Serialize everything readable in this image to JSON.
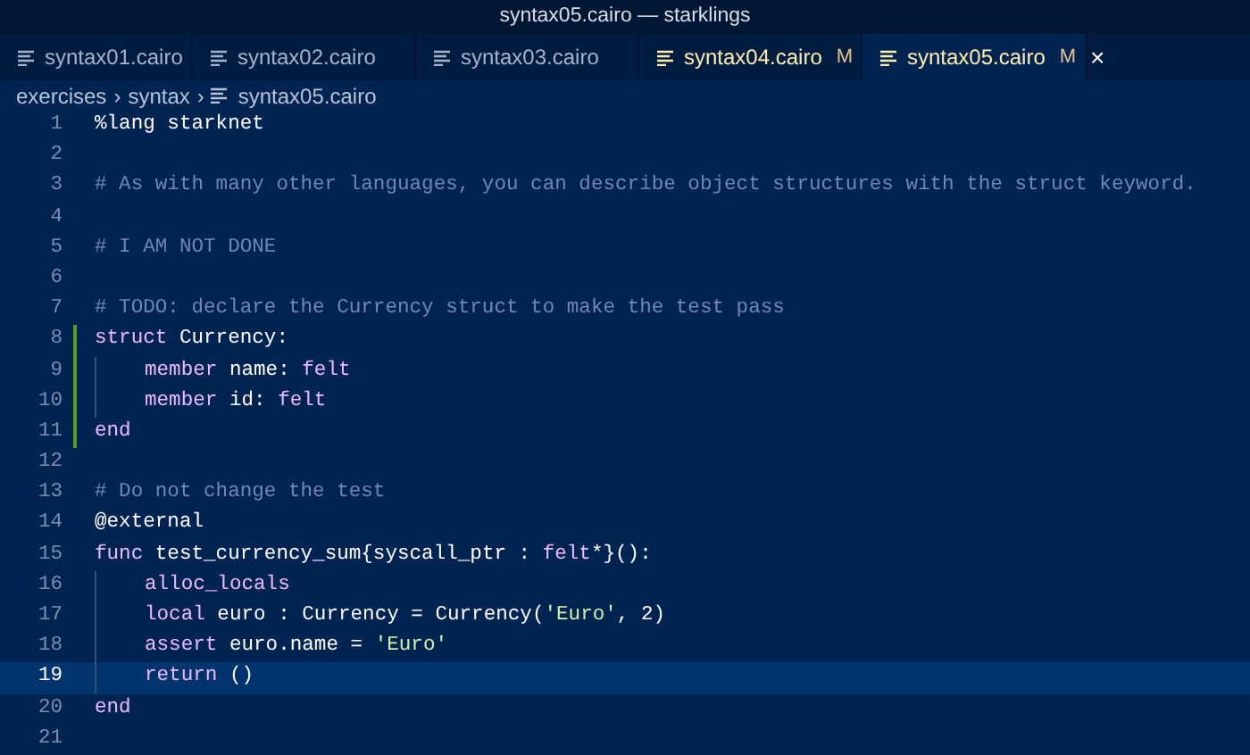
{
  "window": {
    "title": "syntax05.cairo — starklings"
  },
  "tabs": [
    {
      "label": "syntax01.cairo",
      "selected": false,
      "modified": false
    },
    {
      "label": "syntax02.cairo",
      "selected": false,
      "modified": false
    },
    {
      "label": "syntax03.cairo",
      "selected": false,
      "modified": false
    },
    {
      "label": "syntax04.cairo",
      "selected": false,
      "modified": true,
      "badge": "M"
    },
    {
      "label": "syntax05.cairo",
      "selected": true,
      "modified": true,
      "badge": "M",
      "close": "×"
    }
  ],
  "breadcrumbs": [
    {
      "label": "exercises",
      "kind": "folder"
    },
    {
      "label": "syntax",
      "kind": "folder"
    },
    {
      "label": "syntax05.cairo",
      "kind": "file"
    }
  ],
  "breadcrumb_separator": "›",
  "editor": {
    "lines": [
      {
        "number": "1",
        "changed": false,
        "current": false,
        "tokens": [
          {
            "kind": "plain",
            "text": "%lang starknet"
          }
        ]
      },
      {
        "number": "2",
        "changed": false,
        "current": false
      },
      {
        "number": "3",
        "changed": false,
        "current": false,
        "tokens": [
          {
            "kind": "comment",
            "text": "# As with many other languages, you can describe object structures with the struct keyword."
          }
        ]
      },
      {
        "number": "4",
        "changed": false,
        "current": false
      },
      {
        "number": "5",
        "changed": false,
        "current": false,
        "tokens": [
          {
            "kind": "comment",
            "text": "# I AM NOT DONE"
          }
        ]
      },
      {
        "number": "6",
        "changed": false,
        "current": false
      },
      {
        "number": "7",
        "changed": false,
        "current": false,
        "tokens": [
          {
            "kind": "comment",
            "text": "# TODO: declare the Currency struct to make the test pass"
          }
        ]
      },
      {
        "number": "8",
        "changed": true,
        "current": false,
        "tokens": [
          {
            "kind": "keyword",
            "text": "struct"
          },
          {
            "kind": "plain",
            "text": " Currency:"
          }
        ],
        "children": [
          {
            "number": "9",
            "changed": true,
            "current": false,
            "tokens": [
              {
                "kind": "keyword",
                "text": "member"
              },
              {
                "kind": "plain",
                "text": " name: "
              },
              {
                "kind": "keyword",
                "text": "felt"
              }
            ]
          },
          {
            "number": "10",
            "changed": true,
            "current": false,
            "tokens": [
              {
                "kind": "keyword",
                "text": "member"
              },
              {
                "kind": "plain",
                "text": " id: "
              },
              {
                "kind": "keyword",
                "text": "felt"
              }
            ]
          }
        ]
      },
      {
        "number": "11",
        "changed": true,
        "current": false,
        "tokens": [
          {
            "kind": "keyword",
            "text": "end"
          }
        ]
      },
      {
        "number": "12",
        "changed": false,
        "current": false
      },
      {
        "number": "13",
        "changed": false,
        "current": false,
        "tokens": [
          {
            "kind": "comment",
            "text": "# Do not change the test"
          }
        ]
      },
      {
        "number": "14",
        "changed": false,
        "current": false,
        "tokens": [
          {
            "kind": "plain",
            "text": "@external"
          }
        ]
      },
      {
        "number": "15",
        "changed": false,
        "current": false,
        "tokens": [
          {
            "kind": "keyword",
            "text": "func"
          },
          {
            "kind": "plain",
            "text": " test_currency_sum{syscall_ptr : "
          },
          {
            "kind": "keyword",
            "text": "felt"
          },
          {
            "kind": "plain",
            "text": "*}():"
          }
        ],
        "children": [
          {
            "number": "16",
            "changed": false,
            "current": false,
            "tokens": [
              {
                "kind": "keyword",
                "text": "alloc_locals"
              }
            ]
          },
          {
            "number": "17",
            "changed": false,
            "current": false,
            "tokens": [
              {
                "kind": "keyword",
                "text": "local"
              },
              {
                "kind": "plain",
                "text": " euro : Currency = Currency("
              },
              {
                "kind": "string",
                "text": "'Euro'"
              },
              {
                "kind": "plain",
                "text": ", 2)"
              }
            ]
          },
          {
            "number": "18",
            "changed": false,
            "current": false,
            "tokens": [
              {
                "kind": "keyword",
                "text": "assert"
              },
              {
                "kind": "plain",
                "text": " euro.name = "
              },
              {
                "kind": "string",
                "text": "'Euro'"
              }
            ]
          },
          {
            "number": "19",
            "changed": false,
            "current": true,
            "tokens": [
              {
                "kind": "keyword",
                "text": "return"
              },
              {
                "kind": "plain",
                "text": " ()"
              }
            ]
          }
        ]
      },
      {
        "number": "20",
        "changed": false,
        "current": false,
        "tokens": [
          {
            "kind": "keyword",
            "text": "end"
          }
        ]
      },
      {
        "number": "21",
        "changed": false,
        "current": false
      }
    ]
  }
}
